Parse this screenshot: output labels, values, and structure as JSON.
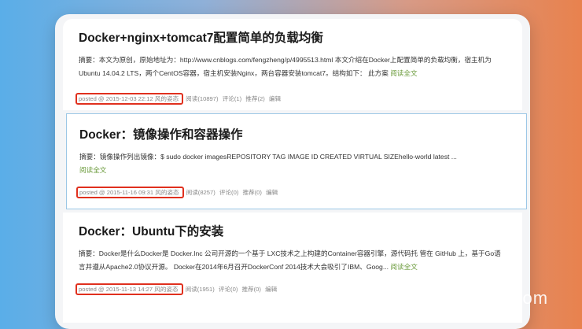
{
  "posts": [
    {
      "title": "Docker+nginx+tomcat7配置简单的负载均衡",
      "summary": "摘要：本文为原创，原始地址为：http://www.cnblogs.com/fengzheng/p/4995513.html 本文介绍在Docker上配置简单的负载均衡，宿主机为Ubuntu 14.04.2 LTS，两个CentOS容器，宿主机安装Nginx，两台容器安装tomcat7。结构如下：  此方案",
      "read_more": "阅读全文",
      "posted": "posted @ 2015-12-03 22:12 风的姿态",
      "reads": "阅读(10897)",
      "comments": "评论(1)",
      "recommends": "推荐(2)",
      "edit": "编辑"
    },
    {
      "title": "Docker：镜像操作和容器操作",
      "summary": "摘要：镜像操作列出镜像：$ sudo docker imagesREPOSITORY TAG IMAGE ID CREATED VIRTUAL SIZEhello-world latest ...",
      "read_more": "阅读全文",
      "posted": "posted @ 2015-11-16 09:31 风的姿态",
      "reads": "阅读(8257)",
      "comments": "评论(0)",
      "recommends": "推荐(0)",
      "edit": "编辑"
    },
    {
      "title": "Docker：Ubuntu下的安装",
      "summary": "摘要：Docker是什么Docker是 Docker.Inc 公司开源的一个基于 LXC技术之上构建的Container容器引擎，源代码托 管在 GitHub 上，基于Go语言并遵从Apache2.0协议开源。 Docker在2014年6月召开DockerConf 2014技术大会吸引了IBM、Goog...",
      "read_more": "阅读全文",
      "posted": "posted @ 2015-11-13 14:27 风的姿态",
      "reads": "阅读(1951)",
      "comments": "评论(0)",
      "recommends": "推荐(0)",
      "edit": "编辑"
    }
  ],
  "watermark": "www.panziye.com",
  "colors": {
    "highlight_border": "#e0301e",
    "read_more": "#6a9a3a",
    "selected_border": "#9cc7e6"
  }
}
